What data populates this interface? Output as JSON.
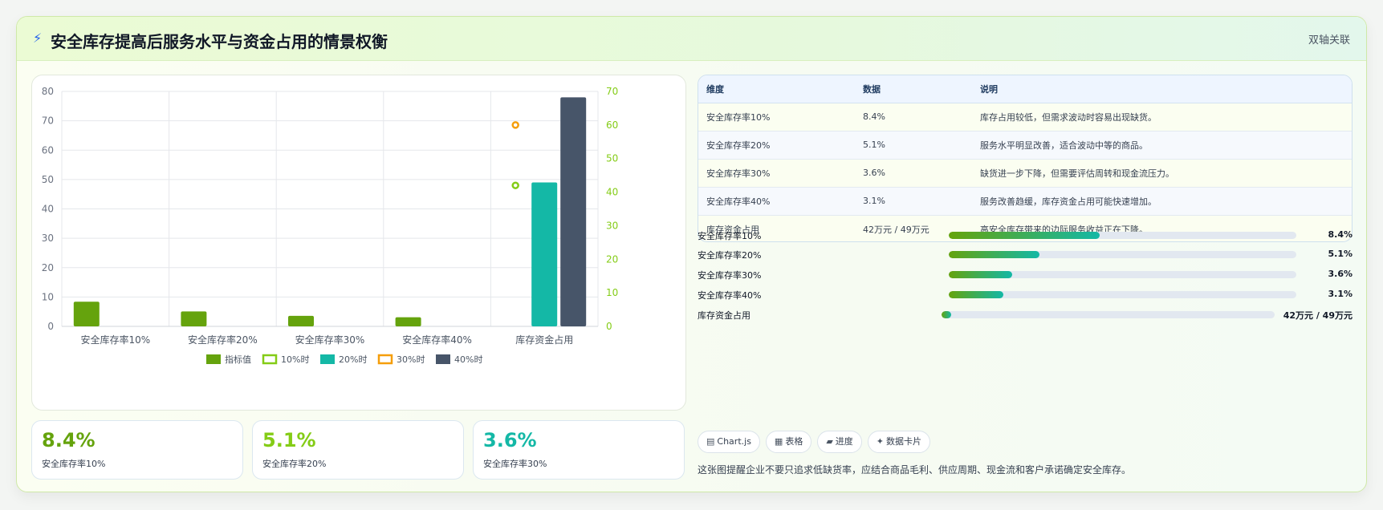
{
  "header": {
    "icon": "lightning-icon",
    "title": "安全库存提高后服务水平与资金占用的情景权衡",
    "badge": "双轴关联"
  },
  "colors": {
    "green": "#65a30d",
    "lime": "#84cc16",
    "teal": "#14b8a6",
    "orange": "#f59e0b",
    "slate": "#475569"
  },
  "chart_data": {
    "type": "bar",
    "categories": [
      "安全库存率10%",
      "安全库存率20%",
      "安全库存率30%",
      "安全库存率40%",
      "库存资金占用"
    ],
    "y_left": {
      "min": 0,
      "max": 80,
      "ticks": [
        "0",
        "10",
        "20",
        "30",
        "40",
        "50",
        "60",
        "70",
        "80"
      ]
    },
    "y_right": {
      "min": 0,
      "max": 70,
      "ticks": [
        "0",
        "10",
        "20",
        "30",
        "40",
        "50",
        "60",
        "70"
      ]
    },
    "grid": true,
    "legend_position": "bottom",
    "series": [
      {
        "name": "指标值",
        "type": "bar",
        "axis": "left",
        "color": "#65a30d",
        "values": [
          8.4,
          5.1,
          3.6,
          3.1,
          null
        ]
      },
      {
        "name": "10%时",
        "type": "point",
        "axis": "right",
        "color": "#84cc16",
        "values": [
          null,
          null,
          null,
          null,
          42
        ]
      },
      {
        "name": "20%时",
        "type": "bar",
        "axis": "left",
        "color": "#14b8a6",
        "values": [
          null,
          null,
          null,
          null,
          49
        ]
      },
      {
        "name": "30%时",
        "type": "point",
        "axis": "right",
        "color": "#f59e0b",
        "values": [
          null,
          null,
          null,
          null,
          60
        ]
      },
      {
        "name": "40%时",
        "type": "bar",
        "axis": "left",
        "color": "#475569",
        "values": [
          null,
          null,
          null,
          null,
          78
        ]
      }
    ]
  },
  "stats": [
    {
      "value": "8.4%",
      "label": "安全库存率10%",
      "color": "#65a30d"
    },
    {
      "value": "5.1%",
      "label": "安全库存率20%",
      "color": "#84cc16"
    },
    {
      "value": "3.6%",
      "label": "安全库存率30%",
      "color": "#14b8a6"
    }
  ],
  "table": {
    "headers": [
      "维度",
      "数据",
      "说明"
    ],
    "rows": [
      [
        "安全库存率10%",
        "8.4%",
        "库存占用较低，但需求波动时容易出现缺货。"
      ],
      [
        "安全库存率20%",
        "5.1%",
        "服务水平明显改善，适合波动中等的商品。"
      ],
      [
        "安全库存率30%",
        "3.6%",
        "缺货进一步下降，但需要评估周转和现金流压力。"
      ],
      [
        "安全库存率40%",
        "3.1%",
        "服务改善趋缓，库存资金占用可能快速增加。"
      ],
      [
        "库存资金占用",
        "42万元 / 49万元",
        "高安全库存带来的边际服务收益正在下降。"
      ]
    ]
  },
  "progress": [
    {
      "label": "安全库存率10%",
      "value": "8.4%",
      "fraction": 0.435
    },
    {
      "label": "安全库存率20%",
      "value": "5.1%",
      "fraction": 0.26
    },
    {
      "label": "安全库存率30%",
      "value": "3.6%",
      "fraction": 0.183
    },
    {
      "label": "安全库存率40%",
      "value": "3.1%",
      "fraction": 0.158
    },
    {
      "label": "库存资金占用",
      "value": "42万元 / 49万元",
      "fraction": 0.03
    }
  ],
  "chips": [
    {
      "icon": "bar-chart-icon",
      "glyph": "▤",
      "label": "Chart.js"
    },
    {
      "icon": "table-icon",
      "glyph": "▦",
      "label": "表格"
    },
    {
      "icon": "progress-icon",
      "glyph": "▰",
      "label": "进度"
    },
    {
      "icon": "sparkle-icon",
      "glyph": "✦",
      "label": "数据卡片"
    }
  ],
  "note": "这张图提醒企业不要只追求低缺货率，应结合商品毛利、供应周期、现金流和客户承诺确定安全库存。"
}
